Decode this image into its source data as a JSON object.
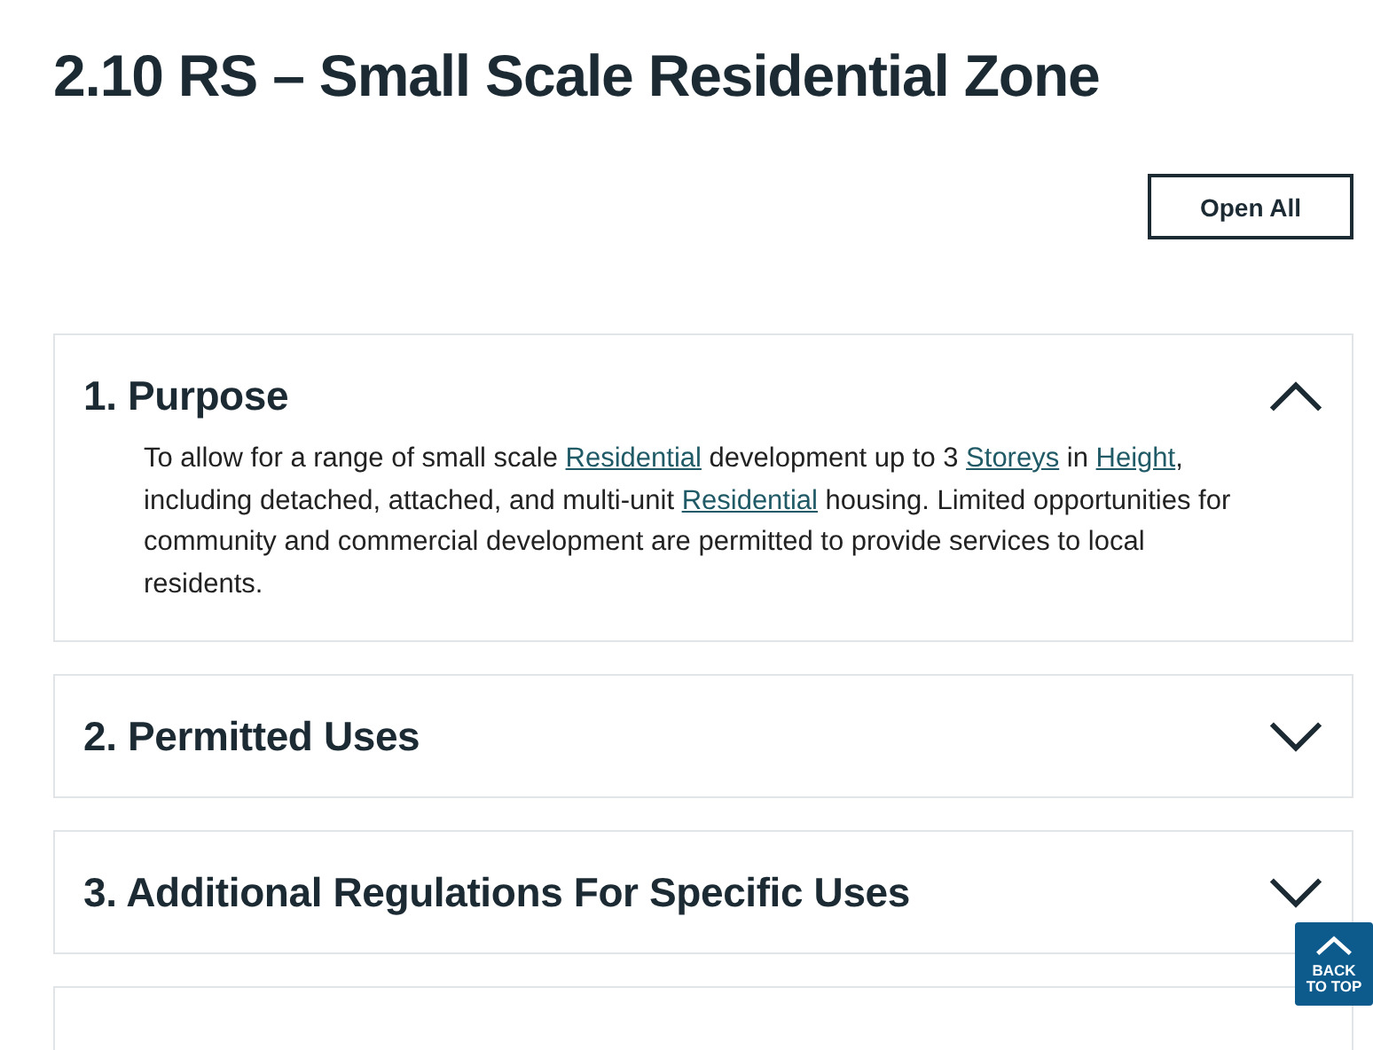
{
  "title": "2.10 RS – Small Scale Residential Zone",
  "open_all_button": "Open All",
  "sections": [
    {
      "title": "1. Purpose",
      "expanded": true,
      "body": [
        {
          "text": "To allow for a range of small scale ",
          "link": false
        },
        {
          "text": "Residential",
          "link": true
        },
        {
          "text": " development up to 3 ",
          "link": false
        },
        {
          "text": "Storeys",
          "link": true
        },
        {
          "text": " in ",
          "link": false
        },
        {
          "text": "Height",
          "link": true
        },
        {
          "text": ", including detached, attached, and multi-unit ",
          "link": false
        },
        {
          "text": "Residential",
          "link": true
        },
        {
          "text": " housing. Limited opportunities for community and commercial development are permitted to provide services to local residents.",
          "link": false
        }
      ]
    },
    {
      "title": "2. Permitted Uses",
      "expanded": false
    },
    {
      "title": "3. Additional Regulations For Specific Uses",
      "expanded": false
    }
  ],
  "back_to_top": {
    "line_1": "BACK",
    "line_2": "TO TOP"
  }
}
